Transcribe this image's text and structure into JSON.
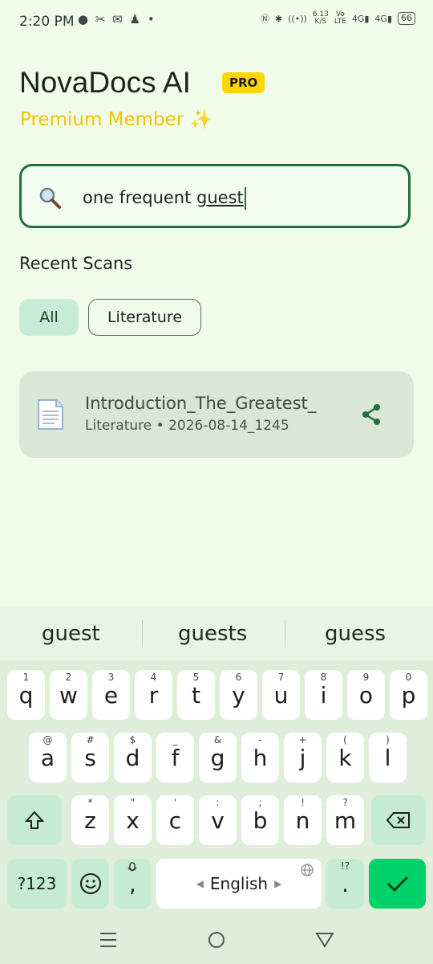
{
  "status_bar": {
    "time": "2:20 PM",
    "left_icons": [
      "chat-icon",
      "tools-icon",
      "mail-icon",
      "person-icon",
      "dot-icon"
    ],
    "net_speed": "6.13",
    "net_unit": "K/S",
    "vo_lte": "Vo",
    "lte": "LTE",
    "signal1": "4G",
    "signal2": "4G",
    "battery": "66"
  },
  "header": {
    "title": "NovaDocs AI",
    "badge": "PRO",
    "subtitle": "Premium Member ✨"
  },
  "search": {
    "text_plain": "one frequent ",
    "text_underlined": "guest"
  },
  "recent": {
    "heading": "Recent Scans",
    "filters": [
      {
        "label": "All",
        "selected": true
      },
      {
        "label": "Literature",
        "selected": false
      }
    ],
    "items": [
      {
        "title": "Introduction_The_Greatest_",
        "category": "Literature",
        "date": "2026-08-14_1245"
      }
    ]
  },
  "keyboard": {
    "suggestions": [
      "guest",
      "guests",
      "guess"
    ],
    "row1": [
      {
        "k": "q",
        "h": "1"
      },
      {
        "k": "w",
        "h": "2"
      },
      {
        "k": "e",
        "h": "3"
      },
      {
        "k": "r",
        "h": "4"
      },
      {
        "k": "t",
        "h": "5"
      },
      {
        "k": "y",
        "h": "6"
      },
      {
        "k": "u",
        "h": "7"
      },
      {
        "k": "i",
        "h": "8"
      },
      {
        "k": "o",
        "h": "9"
      },
      {
        "k": "p",
        "h": "0"
      }
    ],
    "row2": [
      {
        "k": "a",
        "h": "@"
      },
      {
        "k": "s",
        "h": "#"
      },
      {
        "k": "d",
        "h": "$"
      },
      {
        "k": "f",
        "h": "_"
      },
      {
        "k": "g",
        "h": "&"
      },
      {
        "k": "h",
        "h": "-"
      },
      {
        "k": "j",
        "h": "+"
      },
      {
        "k": "k",
        "h": "("
      },
      {
        "k": "l",
        "h": ")"
      }
    ],
    "row3": [
      {
        "k": "z",
        "h": "*"
      },
      {
        "k": "x",
        "h": "\""
      },
      {
        "k": "c",
        "h": "'"
      },
      {
        "k": "v",
        "h": ":"
      },
      {
        "k": "b",
        "h": ";"
      },
      {
        "k": "n",
        "h": "!"
      },
      {
        "k": "m",
        "h": "?"
      }
    ],
    "symbols_label": "?123",
    "comma": ",",
    "space_label": "English",
    "period": ".",
    "period_hint": "!?"
  },
  "colors": {
    "accent": "#1f6f3f",
    "badge": "#ffd600",
    "enter": "#00d26a"
  }
}
